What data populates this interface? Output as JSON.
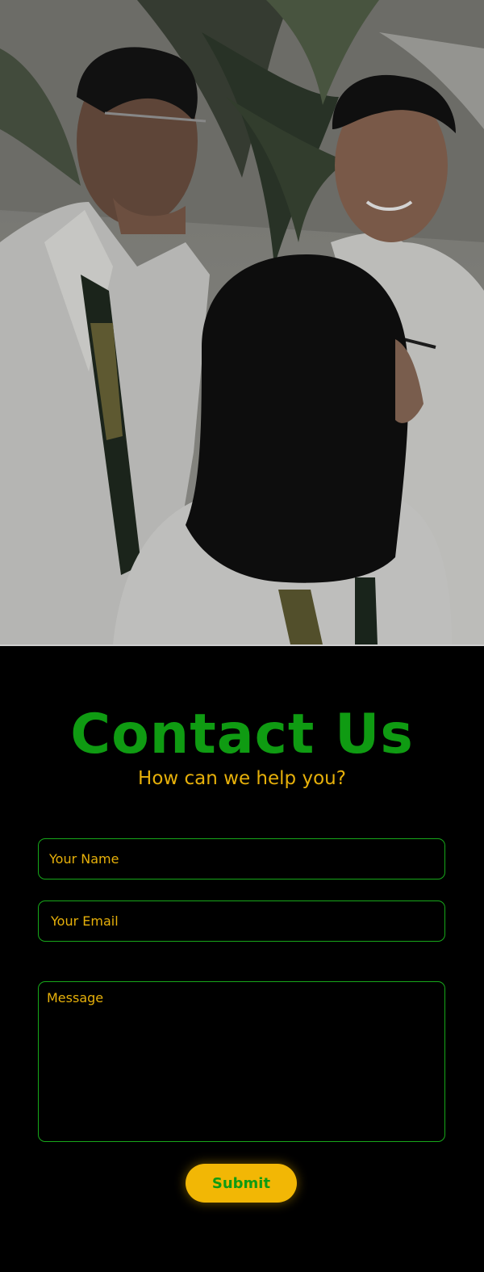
{
  "hero": {
    "image_alt": "Students in white uniforms with lanyards talking under palm leaves"
  },
  "contact": {
    "title": "Contact Us",
    "subtitle": "How can we help you?",
    "name_placeholder": "Your Name",
    "email_placeholder": "Your Email",
    "message_placeholder": "Message",
    "submit_label": "Submit"
  },
  "colors": {
    "title_green": "#0f9b12",
    "accent_yellow": "#f2b705",
    "field_border": "#17a81a",
    "background": "#000000"
  }
}
